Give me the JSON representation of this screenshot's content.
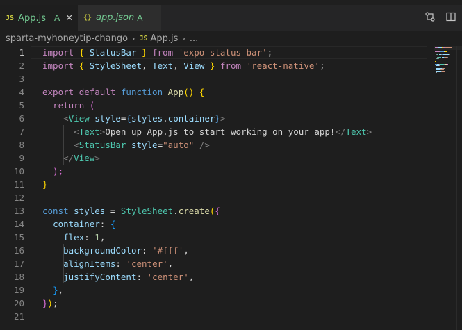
{
  "tabs": [
    {
      "icon": "JS",
      "label": "App.js",
      "badge": "A",
      "close": "✕",
      "active": true
    },
    {
      "icon": "{}",
      "label": "app.json",
      "badge": "A",
      "active": false
    }
  ],
  "breadcrumb": {
    "folder": "sparta-myhoneytip-chango",
    "sep": "›",
    "file_icon": "JS",
    "file": "App.js",
    "sep2": "›",
    "more": "..."
  },
  "editor": {
    "current_line": 1,
    "line_numbers": [
      "1",
      "2",
      "3",
      "4",
      "5",
      "6",
      "7",
      "8",
      "9",
      "10",
      "11",
      "12",
      "13",
      "14",
      "15",
      "16",
      "17",
      "18",
      "19",
      "20",
      "21"
    ],
    "lines": [
      [
        [
          "kw",
          "import "
        ],
        [
          "br1",
          "{ "
        ],
        [
          "id",
          "StatusBar"
        ],
        [
          "br1",
          " } "
        ],
        [
          "kw",
          "from "
        ],
        [
          "s",
          "'expo-status-bar'"
        ],
        [
          "txt",
          ";"
        ]
      ],
      [
        [
          "kw",
          "import "
        ],
        [
          "br1",
          "{ "
        ],
        [
          "id",
          "StyleSheet"
        ],
        [
          "txt",
          ", "
        ],
        [
          "id",
          "Text"
        ],
        [
          "txt",
          ", "
        ],
        [
          "id",
          "View"
        ],
        [
          "br1",
          " } "
        ],
        [
          "kw",
          "from "
        ],
        [
          "s",
          "'react-native'"
        ],
        [
          "txt",
          ";"
        ]
      ],
      [],
      [
        [
          "kw",
          "export "
        ],
        [
          "kw",
          "default "
        ],
        [
          "st",
          "function "
        ],
        [
          "fn",
          "App"
        ],
        [
          "br1",
          "() {"
        ]
      ],
      [
        [
          "txt",
          "  "
        ],
        [
          "kw",
          "return "
        ],
        [
          "br2",
          "("
        ]
      ],
      [
        [
          "txt",
          "    "
        ],
        [
          "gray",
          "<"
        ],
        [
          "tag",
          "View"
        ],
        [
          "txt",
          " "
        ],
        [
          "id",
          "style"
        ],
        [
          "txt",
          "="
        ],
        [
          "st",
          "{"
        ],
        [
          "id",
          "styles"
        ],
        [
          "txt",
          "."
        ],
        [
          "id",
          "container"
        ],
        [
          "st",
          "}"
        ],
        [
          "gray",
          ">"
        ]
      ],
      [
        [
          "txt",
          "      "
        ],
        [
          "gray",
          "<"
        ],
        [
          "tag",
          "Text"
        ],
        [
          "gray",
          ">"
        ],
        [
          "txt",
          "Open up App.js to start working on your app!"
        ],
        [
          "gray",
          "</"
        ],
        [
          "tag",
          "Text"
        ],
        [
          "gray",
          ">"
        ]
      ],
      [
        [
          "txt",
          "      "
        ],
        [
          "gray",
          "<"
        ],
        [
          "tag",
          "StatusBar"
        ],
        [
          "txt",
          " "
        ],
        [
          "id",
          "style"
        ],
        [
          "txt",
          "="
        ],
        [
          "s",
          "\"auto\""
        ],
        [
          "txt",
          " "
        ],
        [
          "gray",
          "/>"
        ]
      ],
      [
        [
          "txt",
          "    "
        ],
        [
          "gray",
          "</"
        ],
        [
          "tag",
          "View"
        ],
        [
          "gray",
          ">"
        ]
      ],
      [
        [
          "txt",
          "  "
        ],
        [
          "br2",
          ");"
        ]
      ],
      [
        [
          "br1",
          "}"
        ]
      ],
      [],
      [
        [
          "st",
          "const "
        ],
        [
          "id",
          "styles"
        ],
        [
          "txt",
          " = "
        ],
        [
          "ty",
          "StyleSheet"
        ],
        [
          "txt",
          "."
        ],
        [
          "fn",
          "create"
        ],
        [
          "br1",
          "("
        ],
        [
          "br2",
          "{"
        ]
      ],
      [
        [
          "txt",
          "  "
        ],
        [
          "id",
          "container"
        ],
        [
          "txt",
          ": "
        ],
        [
          "br3",
          "{"
        ]
      ],
      [
        [
          "txt",
          "    "
        ],
        [
          "id",
          "flex"
        ],
        [
          "txt",
          ": "
        ],
        [
          "num",
          "1"
        ],
        [
          "txt",
          ","
        ]
      ],
      [
        [
          "txt",
          "    "
        ],
        [
          "id",
          "backgroundColor"
        ],
        [
          "txt",
          ": "
        ],
        [
          "s",
          "'#fff'"
        ],
        [
          "txt",
          ","
        ]
      ],
      [
        [
          "txt",
          "    "
        ],
        [
          "id",
          "alignItems"
        ],
        [
          "txt",
          ": "
        ],
        [
          "s",
          "'center'"
        ],
        [
          "txt",
          ","
        ]
      ],
      [
        [
          "txt",
          "    "
        ],
        [
          "id",
          "justifyContent"
        ],
        [
          "txt",
          ": "
        ],
        [
          "s",
          "'center'"
        ],
        [
          "txt",
          ","
        ]
      ],
      [
        [
          "txt",
          "  "
        ],
        [
          "br3",
          "}"
        ],
        [
          "txt",
          ","
        ]
      ],
      [
        [
          "br2",
          "}"
        ],
        [
          "br1",
          ")"
        ],
        [
          "txt",
          ";"
        ]
      ],
      []
    ]
  },
  "colors": {
    "editor_bg": "#1e1e1e",
    "tabbar_bg": "#252526",
    "keyword": "#c586c0",
    "storage": "#569cd6",
    "identifier": "#9cdcfe",
    "string": "#ce9178",
    "function": "#dcdcaa",
    "tag": "#4ec9b0",
    "modified": "#73c991"
  },
  "icons": {
    "compare": "compare-changes-icon",
    "split": "split-editor-icon"
  }
}
